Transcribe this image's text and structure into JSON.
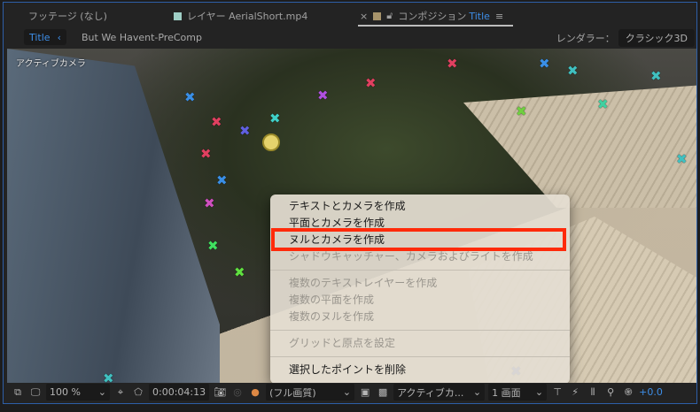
{
  "tabs": [
    {
      "label": "フッテージ (なし)"
    },
    {
      "label": "レイヤー AerialShort.mp4",
      "swatch": "#9fcfc6"
    },
    {
      "label": "コンポジション",
      "name": "Title",
      "swatch": "#a7946b",
      "close": "×",
      "menu": "≡"
    }
  ],
  "breadcrumb": {
    "current": "Title",
    "arrow": "‹",
    "next": "But We Havent-PreComp"
  },
  "renderer": {
    "label": "レンダラー：",
    "value": "クラシック3D"
  },
  "viewer": {
    "overlay_label": "アクティブカメラ"
  },
  "context_menu": {
    "items": [
      {
        "label": "テキストとカメラを作成",
        "enabled": true
      },
      {
        "label": "平面とカメラを作成",
        "enabled": true
      },
      {
        "label": "ヌルとカメラを作成",
        "enabled": true,
        "highlighted": true
      },
      {
        "label": "シャドウキャッチャー、カメラおよびライトを作成",
        "enabled": false
      },
      {
        "label": "複数のテキストレイヤーを作成",
        "enabled": false
      },
      {
        "label": "複数の平面を作成",
        "enabled": false
      },
      {
        "label": "複数のヌルを作成",
        "enabled": false
      },
      {
        "label": "グリッドと原点を設定",
        "enabled": false
      },
      {
        "label": "選択したポイントを削除",
        "enabled": true
      }
    ]
  },
  "toolbar": {
    "zoom": "100 %",
    "timecode": "0:00:04:13",
    "resolution": "(フル画質)",
    "view": "アクティブカ...",
    "layout": "1 画面",
    "exposure": "+0.0",
    "chevron": "⌄"
  },
  "colors": {
    "accent": "#3d8ee8",
    "highlight_box": "#ff2a0a"
  }
}
